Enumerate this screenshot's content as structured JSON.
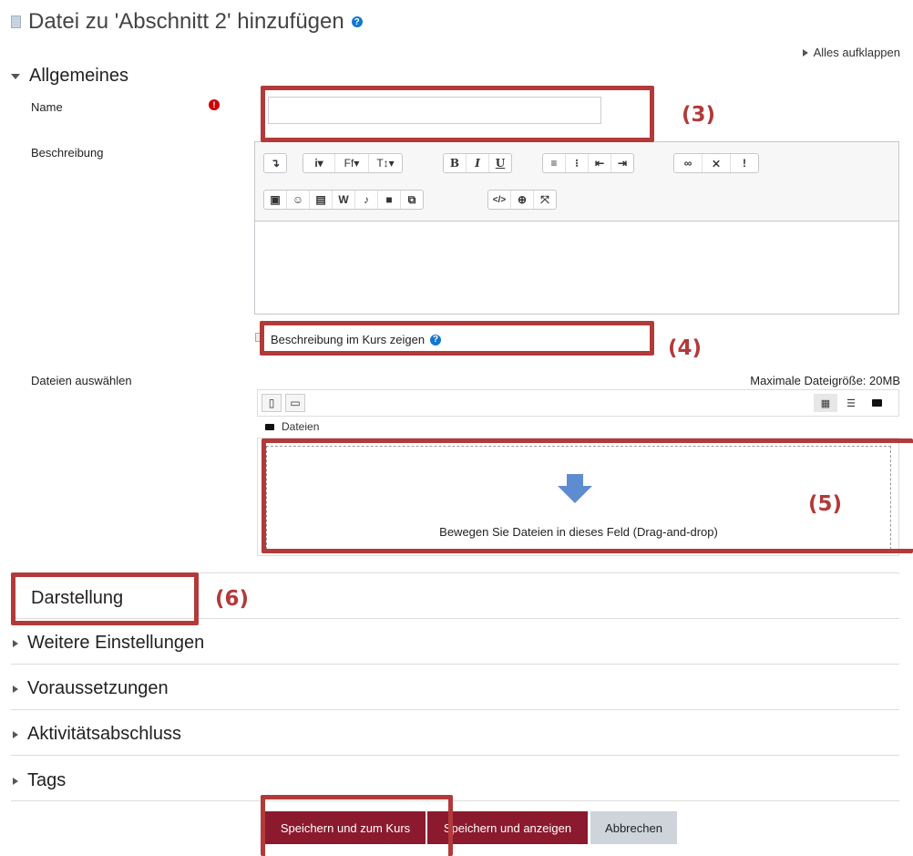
{
  "page": {
    "title": "Datei zu 'Abschnitt 2' hinzufügen",
    "expand_all": "Alles aufklappen"
  },
  "general": {
    "heading": "Allgemeines",
    "name_label": "Name",
    "name_value": "",
    "description_label": "Beschreibung",
    "show_description_label": "Beschreibung im Kurs zeigen",
    "files_label": "Dateien auswählen",
    "max_size": "Maximale Dateigröße: 20MB",
    "files_folder": "Dateien",
    "drop_text": "Bewegen Sie Dateien in dieses Feld (Drag-and-drop)"
  },
  "editor": {
    "row1": [
      [
        "↴"
      ],
      [
        "i▾",
        "Ff▾",
        "T↕▾"
      ],
      [
        "B",
        "I",
        "U"
      ],
      [
        "≡",
        "⁝≡",
        "⇤",
        "⇥"
      ],
      [
        "🔗",
        "⛓",
        "!"
      ]
    ],
    "row2": [
      [
        "▣",
        "☺",
        "▤",
        "W",
        "🎙",
        "■",
        "⧉"
      ],
      [
        "</>",
        "⊕",
        "⤧"
      ]
    ]
  },
  "sections": [
    {
      "label": "Darstellung"
    },
    {
      "label": "Weitere Einstellungen"
    },
    {
      "label": "Voraussetzungen"
    },
    {
      "label": "Aktivitätsabschluss"
    },
    {
      "label": "Tags"
    }
  ],
  "buttons": {
    "save_return": "Speichern und zum Kurs",
    "save_display": "Speichern und anzeigen",
    "cancel": "Abbrechen"
  },
  "annotations": {
    "a3": "(3)",
    "a4": "(4)",
    "a5": "(5)",
    "a6": "(6)"
  },
  "colors": {
    "primary": "#8b1a2e",
    "annotation": "#b23a3a"
  }
}
